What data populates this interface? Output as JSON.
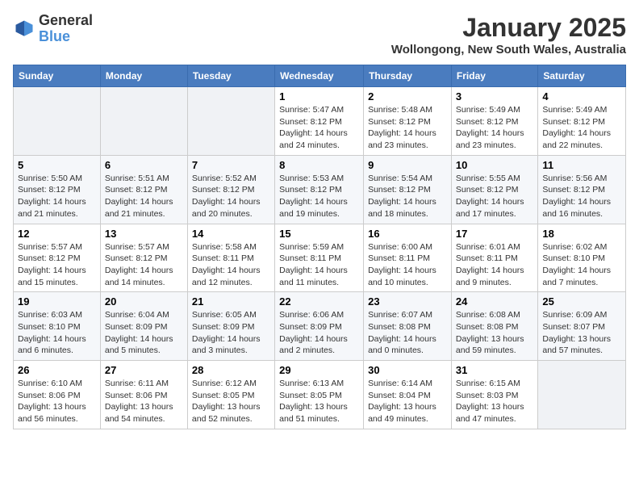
{
  "header": {
    "logo_general": "General",
    "logo_blue": "Blue",
    "month": "January 2025",
    "location": "Wollongong, New South Wales, Australia"
  },
  "weekdays": [
    "Sunday",
    "Monday",
    "Tuesday",
    "Wednesday",
    "Thursday",
    "Friday",
    "Saturday"
  ],
  "weeks": [
    [
      {
        "day": "",
        "info": ""
      },
      {
        "day": "",
        "info": ""
      },
      {
        "day": "",
        "info": ""
      },
      {
        "day": "1",
        "info": "Sunrise: 5:47 AM\nSunset: 8:12 PM\nDaylight: 14 hours\nand 24 minutes."
      },
      {
        "day": "2",
        "info": "Sunrise: 5:48 AM\nSunset: 8:12 PM\nDaylight: 14 hours\nand 23 minutes."
      },
      {
        "day": "3",
        "info": "Sunrise: 5:49 AM\nSunset: 8:12 PM\nDaylight: 14 hours\nand 23 minutes."
      },
      {
        "day": "4",
        "info": "Sunrise: 5:49 AM\nSunset: 8:12 PM\nDaylight: 14 hours\nand 22 minutes."
      }
    ],
    [
      {
        "day": "5",
        "info": "Sunrise: 5:50 AM\nSunset: 8:12 PM\nDaylight: 14 hours\nand 21 minutes."
      },
      {
        "day": "6",
        "info": "Sunrise: 5:51 AM\nSunset: 8:12 PM\nDaylight: 14 hours\nand 21 minutes."
      },
      {
        "day": "7",
        "info": "Sunrise: 5:52 AM\nSunset: 8:12 PM\nDaylight: 14 hours\nand 20 minutes."
      },
      {
        "day": "8",
        "info": "Sunrise: 5:53 AM\nSunset: 8:12 PM\nDaylight: 14 hours\nand 19 minutes."
      },
      {
        "day": "9",
        "info": "Sunrise: 5:54 AM\nSunset: 8:12 PM\nDaylight: 14 hours\nand 18 minutes."
      },
      {
        "day": "10",
        "info": "Sunrise: 5:55 AM\nSunset: 8:12 PM\nDaylight: 14 hours\nand 17 minutes."
      },
      {
        "day": "11",
        "info": "Sunrise: 5:56 AM\nSunset: 8:12 PM\nDaylight: 14 hours\nand 16 minutes."
      }
    ],
    [
      {
        "day": "12",
        "info": "Sunrise: 5:57 AM\nSunset: 8:12 PM\nDaylight: 14 hours\nand 15 minutes."
      },
      {
        "day": "13",
        "info": "Sunrise: 5:57 AM\nSunset: 8:12 PM\nDaylight: 14 hours\nand 14 minutes."
      },
      {
        "day": "14",
        "info": "Sunrise: 5:58 AM\nSunset: 8:11 PM\nDaylight: 14 hours\nand 12 minutes."
      },
      {
        "day": "15",
        "info": "Sunrise: 5:59 AM\nSunset: 8:11 PM\nDaylight: 14 hours\nand 11 minutes."
      },
      {
        "day": "16",
        "info": "Sunrise: 6:00 AM\nSunset: 8:11 PM\nDaylight: 14 hours\nand 10 minutes."
      },
      {
        "day": "17",
        "info": "Sunrise: 6:01 AM\nSunset: 8:11 PM\nDaylight: 14 hours\nand 9 minutes."
      },
      {
        "day": "18",
        "info": "Sunrise: 6:02 AM\nSunset: 8:10 PM\nDaylight: 14 hours\nand 7 minutes."
      }
    ],
    [
      {
        "day": "19",
        "info": "Sunrise: 6:03 AM\nSunset: 8:10 PM\nDaylight: 14 hours\nand 6 minutes."
      },
      {
        "day": "20",
        "info": "Sunrise: 6:04 AM\nSunset: 8:09 PM\nDaylight: 14 hours\nand 5 minutes."
      },
      {
        "day": "21",
        "info": "Sunrise: 6:05 AM\nSunset: 8:09 PM\nDaylight: 14 hours\nand 3 minutes."
      },
      {
        "day": "22",
        "info": "Sunrise: 6:06 AM\nSunset: 8:09 PM\nDaylight: 14 hours\nand 2 minutes."
      },
      {
        "day": "23",
        "info": "Sunrise: 6:07 AM\nSunset: 8:08 PM\nDaylight: 14 hours\nand 0 minutes."
      },
      {
        "day": "24",
        "info": "Sunrise: 6:08 AM\nSunset: 8:08 PM\nDaylight: 13 hours\nand 59 minutes."
      },
      {
        "day": "25",
        "info": "Sunrise: 6:09 AM\nSunset: 8:07 PM\nDaylight: 13 hours\nand 57 minutes."
      }
    ],
    [
      {
        "day": "26",
        "info": "Sunrise: 6:10 AM\nSunset: 8:06 PM\nDaylight: 13 hours\nand 56 minutes."
      },
      {
        "day": "27",
        "info": "Sunrise: 6:11 AM\nSunset: 8:06 PM\nDaylight: 13 hours\nand 54 minutes."
      },
      {
        "day": "28",
        "info": "Sunrise: 6:12 AM\nSunset: 8:05 PM\nDaylight: 13 hours\nand 52 minutes."
      },
      {
        "day": "29",
        "info": "Sunrise: 6:13 AM\nSunset: 8:05 PM\nDaylight: 13 hours\nand 51 minutes."
      },
      {
        "day": "30",
        "info": "Sunrise: 6:14 AM\nSunset: 8:04 PM\nDaylight: 13 hours\nand 49 minutes."
      },
      {
        "day": "31",
        "info": "Sunrise: 6:15 AM\nSunset: 8:03 PM\nDaylight: 13 hours\nand 47 minutes."
      },
      {
        "day": "",
        "info": ""
      }
    ]
  ]
}
